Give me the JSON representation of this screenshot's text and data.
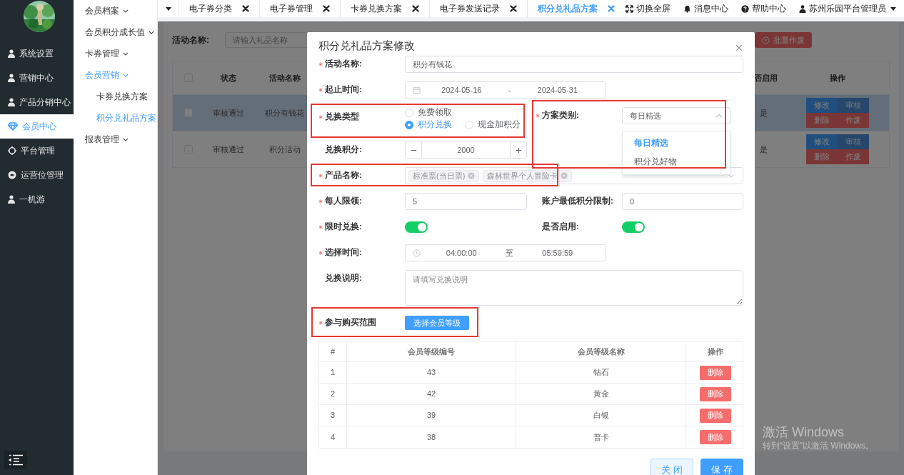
{
  "sidebar": {
    "items": [
      {
        "label": "系统设置",
        "selected": false
      },
      {
        "label": "营销中心",
        "selected": false
      },
      {
        "label": "产品分销中心",
        "selected": false
      },
      {
        "label": "会员中心",
        "selected": true
      },
      {
        "label": "平台管理",
        "selected": false
      },
      {
        "label": "运营位管理",
        "selected": false
      },
      {
        "label": "一机游",
        "selected": false
      }
    ]
  },
  "submenu": {
    "items": [
      {
        "label": "会员档案",
        "selected": false
      },
      {
        "label": "会员积分成长值",
        "selected": false
      },
      {
        "label": "卡券管理",
        "selected": false
      },
      {
        "label": "会员营销",
        "selected": true,
        "children": [
          {
            "label": "卡券兑换方案",
            "selected": false
          },
          {
            "label": "积分兑礼品方案",
            "selected": true
          }
        ]
      },
      {
        "label": "报表管理",
        "selected": false
      }
    ]
  },
  "tabs": [
    {
      "label": "电子券分类",
      "selected": false
    },
    {
      "label": "电子券管理",
      "selected": false
    },
    {
      "label": "卡券兑换方案",
      "selected": false
    },
    {
      "label": "电子券发送记录",
      "selected": false
    },
    {
      "label": "积分兑礼品方案",
      "selected": true
    }
  ],
  "header_actions": [
    {
      "label": "切换全屏",
      "kind": "fullscreen"
    },
    {
      "label": "消息中心",
      "kind": "bell"
    },
    {
      "label": "帮助中心",
      "kind": "help"
    },
    {
      "label": "苏州乐园平台管理员",
      "kind": "user"
    }
  ],
  "list_page": {
    "search_label": "活动名称:",
    "search_placeholder": "请输入礼品名称",
    "batch_button": "批量作废",
    "select_all_checked": false,
    "columns": [
      "状态",
      "活动名称",
      "否启用",
      "操作"
    ],
    "rows": [
      {
        "status": "审核通过",
        "name": "积分有钱花",
        "enabled": "是",
        "selected": true,
        "checked": false,
        "actions": [
          {
            "label": "修改",
            "kind": "primary",
            "disabled": false
          },
          {
            "label": "审核",
            "kind": "primary",
            "disabled": true
          },
          {
            "label": "删除",
            "kind": "danger",
            "disabled": false
          },
          {
            "label": "作废",
            "kind": "danger",
            "disabled": false
          }
        ]
      },
      {
        "status": "审核通过",
        "name": "积分活动",
        "enabled": "是",
        "selected": false,
        "checked": false,
        "actions": [
          {
            "label": "修改",
            "kind": "primary",
            "disabled": false
          },
          {
            "label": "审核",
            "kind": "primary",
            "disabled": true
          },
          {
            "label": "删除",
            "kind": "danger",
            "disabled": false
          },
          {
            "label": "作废",
            "kind": "danger",
            "disabled": false
          }
        ]
      }
    ]
  },
  "dialog": {
    "title": "积分兑礼品方案修改",
    "rows": [
      [
        {
          "kind": "text",
          "label": "活动名称:",
          "required": true,
          "highlighted": false,
          "value": "积分有钱花"
        }
      ],
      [
        {
          "kind": "daterange",
          "label": "起止时间:",
          "required": true,
          "highlighted": false,
          "start": "2024-05-16",
          "separator": "-",
          "end": "2024-05-31"
        }
      ],
      [
        {
          "kind": "radio",
          "label": "兑换类型",
          "required": true,
          "highlighted": true,
          "options": [
            {
              "label": "免费领取",
              "selected": false
            },
            {
              "label": "积分兑换",
              "selected": true
            },
            {
              "label": "现金加积分",
              "selected": false
            }
          ]
        },
        {
          "kind": "select",
          "label": "方案类别:",
          "required": true,
          "highlighted": true,
          "value": "每日精选",
          "expanded": true,
          "options": [
            {
              "label": "每日精选",
              "selected": true
            },
            {
              "label": "积分兑好物",
              "selected": false
            }
          ]
        }
      ],
      [
        {
          "kind": "number",
          "label": "兑换积分:",
          "required": false,
          "highlighted": false,
          "value": "2000"
        }
      ],
      [
        {
          "kind": "tags",
          "label": "产品名称:",
          "required": true,
          "highlighted": true,
          "tags": [
            "标准票(当日票)",
            "森林世界个人冒险卡"
          ]
        }
      ],
      [
        {
          "kind": "text",
          "label": "每人限领:",
          "required": true,
          "highlighted": false,
          "value": "5"
        },
        {
          "kind": "text",
          "label": "账户最低积分限制:",
          "required": false,
          "highlighted": false,
          "value": "0"
        }
      ],
      [
        {
          "kind": "switch",
          "label": "限时兑换:",
          "required": true,
          "highlighted": false,
          "on": true
        },
        {
          "kind": "switch",
          "label": "是否启用:",
          "required": false,
          "highlighted": false,
          "on": true
        }
      ],
      [
        {
          "kind": "timerange",
          "label": "选择时间:",
          "required": true,
          "highlighted": false,
          "start": "04:00:00",
          "separator": "至",
          "end": "05:59:59"
        }
      ],
      [
        {
          "kind": "textarea",
          "label": "兑换说明:",
          "required": false,
          "highlighted": false,
          "placeholder": "请填写兑换说明"
        }
      ],
      [
        {
          "kind": "button",
          "label": "参与购买范围",
          "required": true,
          "highlighted": true,
          "button": "选择会员等级"
        }
      ]
    ],
    "table": {
      "columns": [
        "#",
        "会员等级编号",
        "会员等级名称",
        "操作"
      ],
      "rows": [
        {
          "index": "1",
          "code": "43",
          "name": "钻石",
          "action": "删除"
        },
        {
          "index": "2",
          "code": "42",
          "name": "黄金",
          "action": "删除"
        },
        {
          "index": "3",
          "code": "39",
          "name": "白银",
          "action": "删除"
        },
        {
          "index": "4",
          "code": "38",
          "name": "普卡",
          "action": "删除"
        }
      ]
    },
    "buttons": [
      {
        "label": "关闭",
        "kind": "secondary"
      },
      {
        "label": "保存",
        "kind": "primary"
      }
    ]
  },
  "os_notice": {
    "title": "激活 Windows",
    "subtitle": "转到“设置”以激活 Windows。"
  }
}
